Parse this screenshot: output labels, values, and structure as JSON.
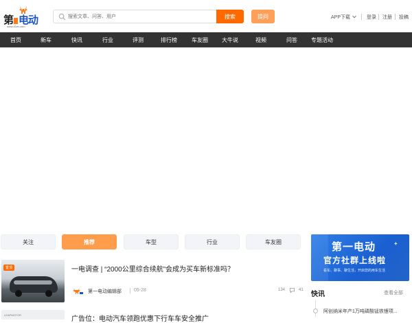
{
  "header": {
    "logo_text_a": "第",
    "logo_text_b": "电动",
    "logo_sub": "www.d1ev.com",
    "search_placeholder": "搜索文章、问答、用户",
    "search_button": "搜索",
    "ask_button": "提问",
    "app_download": "APP下载",
    "login": "登录",
    "register": "注册",
    "submit": "投稿"
  },
  "nav": {
    "items": [
      "首页",
      "新车",
      "快讯",
      "行业",
      "评测",
      "排行榜",
      "车友圈",
      "大牛说",
      "视频",
      "问答",
      "专题活动"
    ]
  },
  "tabs": {
    "items": [
      "关注",
      "推荐",
      "车型",
      "行业",
      "车友圈"
    ],
    "active": "推荐"
  },
  "article": {
    "badge": "置顶",
    "title": "一电调查 | “2000公里综合续航”会成为买车新标准吗？",
    "author": "第一电动编辑部",
    "date": "05-28",
    "views": "134",
    "comments": "41"
  },
  "next_article": {
    "title": "广告位：电动汽车领跑优惠下行车车安全推广",
    "thumb_text": "LEAPMOTOR"
  },
  "promo": {
    "line1": "第一电动",
    "line2": "官方社群上线啦",
    "line3": "看车、聊事、聊生活，开启您的用车生活",
    "plus": "+"
  },
  "flash": {
    "heading": "快讯",
    "view_all": "查看全部",
    "first_item": "阿创纳米年产1万吨磷酸锰铁锂项..."
  },
  "colors": {
    "accent": "#ff6a00",
    "nav_bg": "#333333",
    "active_tab": "#ff9d4d",
    "promo_blue": "#1a5fd1"
  }
}
